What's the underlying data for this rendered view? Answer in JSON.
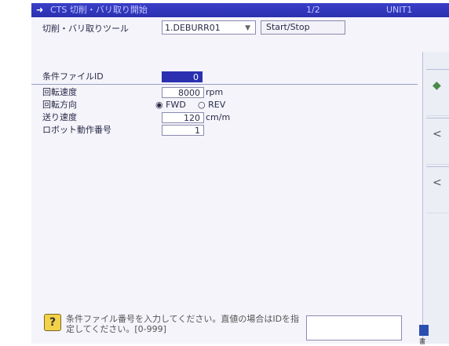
{
  "titlebar": {
    "arrow": "➜",
    "title": "CTS 切削・バリ取り開始",
    "page": "1/2",
    "unit": "UNIT1"
  },
  "tool": {
    "label": "切削・バリ取りツール",
    "selected": "1.DEBURR01",
    "start_stop": "Start/Stop"
  },
  "form": {
    "condition_file_id": {
      "label": "条件ファイルID",
      "value": "0"
    },
    "rotation_speed": {
      "label": "回転速度",
      "value": "8000",
      "unit": "rpm"
    },
    "rotation_direction": {
      "label": "回転方向",
      "options": [
        "FWD",
        "REV"
      ],
      "selected": "FWD"
    },
    "feed_speed": {
      "label": "送り速度",
      "value": "120",
      "unit": "cm/m"
    },
    "robot_operation_no": {
      "label": "ロボット動作番号",
      "value": "1"
    }
  },
  "help": {
    "icon": "question-icon",
    "text": "条件ファイル番号を入力してください。直値の場合はIDを指定してください。[0-999]"
  },
  "side": {
    "glyphs": [
      "◆",
      "<",
      "<"
    ],
    "bottom_label": "書"
  },
  "colors": {
    "titlebar": "#2a30b0",
    "background": "#f4f4fa",
    "selected_field": "#2a30b0"
  }
}
